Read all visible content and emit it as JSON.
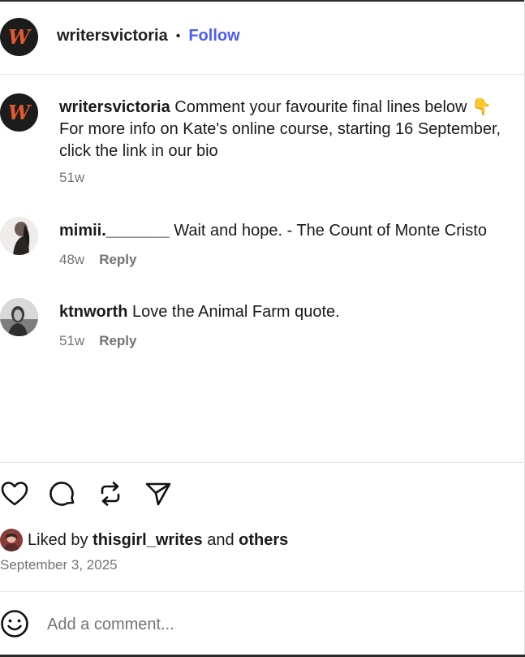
{
  "header": {
    "avatar_letter": "W",
    "username": "writersvictoria",
    "separator": "•",
    "follow_label": "Follow"
  },
  "caption": {
    "avatar_letter": "W",
    "username": "writersvictoria",
    "text_line1": "Comment your favourite final lines below 👇",
    "text_line2": "For more info on Kate's online course, starting 16 September,",
    "text_line3": "click the link in our bio",
    "time": "51w"
  },
  "comments": [
    {
      "username": "mimii._______",
      "text": "Wait and hope. - The Count of Monte Cristo",
      "time": "48w",
      "reply_label": "Reply"
    },
    {
      "username": "ktnworth",
      "text": "Love the Animal Farm quote.",
      "time": "51w",
      "reply_label": "Reply"
    }
  ],
  "actions": {
    "icons": [
      "heart-icon",
      "comment-icon",
      "repost-icon",
      "share-icon"
    ]
  },
  "likes": {
    "prefix": "Liked by",
    "user": "thisgirl_writes",
    "connector": "and",
    "others": "others"
  },
  "post_date": "September 3, 2025",
  "comment_box": {
    "placeholder": "Add a comment..."
  },
  "colors": {
    "follow": "#4a5df9",
    "muted": "#737373",
    "brand_avatar_bg": "#1c1c1c",
    "brand_avatar_fg": "#e25a2e"
  }
}
